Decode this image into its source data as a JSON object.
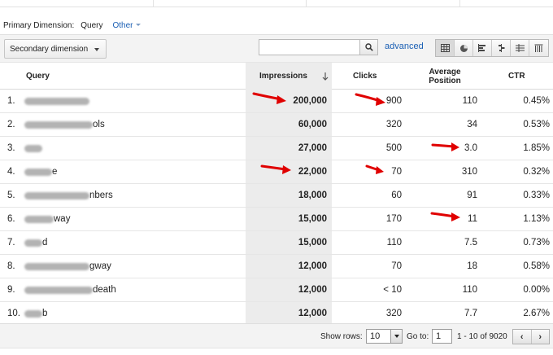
{
  "primary_dimension": {
    "label": "Primary Dimension:",
    "value": "Query",
    "other_label": "Other"
  },
  "toolbar": {
    "secondary_dimension_label": "Secondary dimension",
    "search_value": "",
    "advanced_label": "advanced",
    "view_icons": [
      "data-table-icon",
      "pie-chart-icon",
      "performance-bar-icon",
      "comparison-icon",
      "pivot-icon",
      "term-cloud-icon"
    ],
    "active_view": 0
  },
  "table": {
    "headers": {
      "query": "Query",
      "impressions": "Impressions",
      "clicks": "Clicks",
      "avg_position": "Average Position",
      "ctr": "CTR"
    },
    "rows": [
      {
        "num": "1.",
        "query_suffix": "",
        "impressions": "200,000",
        "clicks": "900",
        "position": "110",
        "ctr": "0.45%"
      },
      {
        "num": "2.",
        "query_suffix": "ols",
        "impressions": "60,000",
        "clicks": "320",
        "position": "34",
        "ctr": "0.53%"
      },
      {
        "num": "3.",
        "query_suffix": "",
        "impressions": "27,000",
        "clicks": "500",
        "position": "3.0",
        "ctr": "1.85%"
      },
      {
        "num": "4.",
        "query_suffix": "e",
        "impressions": "22,000",
        "clicks": "70",
        "position": "310",
        "ctr": "0.32%"
      },
      {
        "num": "5.",
        "query_suffix": "nbers",
        "impressions": "18,000",
        "clicks": "60",
        "position": "91",
        "ctr": "0.33%"
      },
      {
        "num": "6.",
        "query_suffix": "way",
        "impressions": "15,000",
        "clicks": "170",
        "position": "11",
        "ctr": "1.13%"
      },
      {
        "num": "7.",
        "query_suffix": "d",
        "impressions": "15,000",
        "clicks": "110",
        "position": "7.5",
        "ctr": "0.73%"
      },
      {
        "num": "8.",
        "query_suffix": "gway",
        "impressions": "12,000",
        "clicks": "70",
        "position": "18",
        "ctr": "0.58%"
      },
      {
        "num": "9.",
        "query_suffix": "death",
        "impressions": "12,000",
        "clicks": "< 10",
        "position": "110",
        "ctr": "0.00%"
      },
      {
        "num": "10.",
        "query_suffix": "b",
        "impressions": "12,000",
        "clicks": "320",
        "position": "7.7",
        "ctr": "2.67%"
      }
    ]
  },
  "footer": {
    "show_rows_label": "Show rows:",
    "show_rows_value": "10",
    "goto_label": "Go to:",
    "goto_value": "1",
    "range_text": "1 - 10 of 9020",
    "prev_label": "‹",
    "next_label": "›"
  },
  "colors": {
    "annotation_arrow": "#e00000",
    "link": "#1a5fb4",
    "sorted_column": "#ececec"
  }
}
